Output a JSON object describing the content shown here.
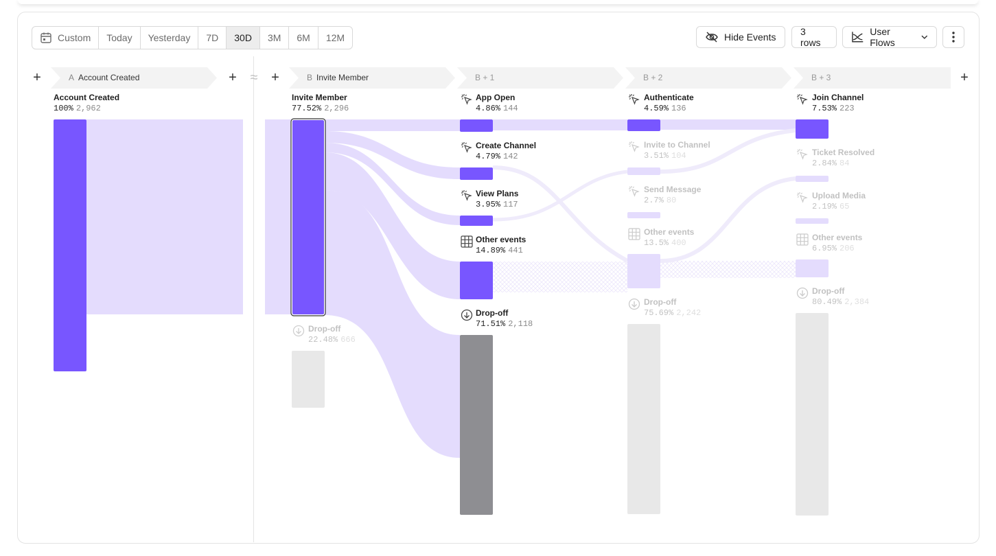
{
  "toolbar": {
    "ranges": [
      "Custom",
      "Today",
      "Yesterday",
      "7D",
      "30D",
      "3M",
      "6M",
      "12M"
    ],
    "active_range": "30D",
    "hide_events_label": "Hide Events",
    "rows_label": "3 rows",
    "view_label": "User Flows"
  },
  "steps": [
    {
      "letter": "A",
      "name": "Account Created"
    },
    {
      "letter": "B",
      "name": "Invite Member"
    },
    {
      "letter": "",
      "name": "B + 1"
    },
    {
      "letter": "",
      "name": "B + 2"
    },
    {
      "letter": "",
      "name": "B + 3"
    }
  ],
  "gap_marker": "≈",
  "nodes": {
    "account_created": {
      "label": "Account Created",
      "pct": "100%",
      "count": "2,962"
    },
    "invite_member": {
      "label": "Invite Member",
      "pct": "77.52%",
      "count": "2,296"
    },
    "invite_dropoff": {
      "label": "Drop-off",
      "pct": "22.48%",
      "count": "666"
    },
    "b1_app_open": {
      "label": "App Open",
      "pct": "4.86%",
      "count": "144"
    },
    "b1_create_channel": {
      "label": "Create Channel",
      "pct": "4.79%",
      "count": "142"
    },
    "b1_view_plans": {
      "label": "View Plans",
      "pct": "3.95%",
      "count": "117"
    },
    "b1_other": {
      "label": "Other events",
      "pct": "14.89%",
      "count": "441"
    },
    "b1_dropoff": {
      "label": "Drop-off",
      "pct": "71.51%",
      "count": "2,118"
    },
    "b2_authenticate": {
      "label": "Authenticate",
      "pct": "4.59%",
      "count": "136"
    },
    "b2_invite_channel": {
      "label": "Invite to Channel",
      "pct": "3.51%",
      "count": "104"
    },
    "b2_send_message": {
      "label": "Send Message",
      "pct": "2.7%",
      "count": "80"
    },
    "b2_other": {
      "label": "Other events",
      "pct": "13.5%",
      "count": "400"
    },
    "b2_dropoff": {
      "label": "Drop-off",
      "pct": "75.69%",
      "count": "2,242"
    },
    "b3_join_channel": {
      "label": "Join Channel",
      "pct": "7.53%",
      "count": "223"
    },
    "b3_ticket_resolved": {
      "label": "Ticket Resolved",
      "pct": "2.84%",
      "count": "84"
    },
    "b3_upload_media": {
      "label": "Upload Media",
      "pct": "2.19%",
      "count": "65"
    },
    "b3_other": {
      "label": "Other events",
      "pct": "6.95%",
      "count": "206"
    },
    "b3_dropoff": {
      "label": "Drop-off",
      "pct": "80.49%",
      "count": "2,384"
    }
  },
  "colors": {
    "accent": "#7856ff",
    "flow": "#e4dcfd",
    "dropoff": "#8e8e92",
    "muted_bar": "#e8e8e8"
  }
}
